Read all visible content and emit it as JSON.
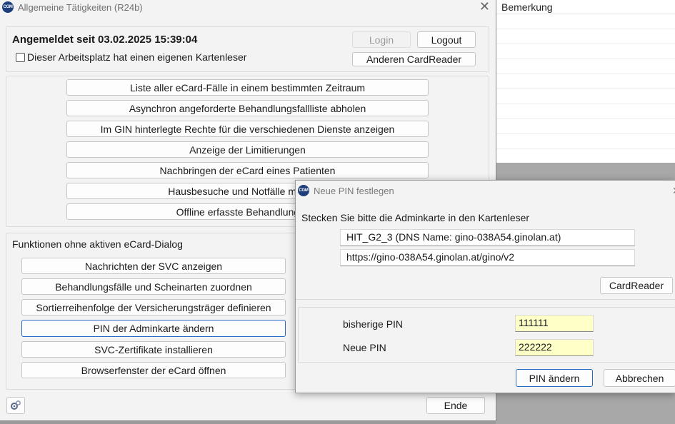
{
  "background_list": {
    "header": "Bemerkung"
  },
  "main_window": {
    "title": "Allgemeine Tätigkeiten (R24b)",
    "app_icon_text": "CGM",
    "close_glyph": "✕",
    "session": {
      "logged_in_label": "Angemeldet seit 03.02.2025 15:39:04",
      "own_reader_checkbox_label": "Dieser Arbeitsplatz hat einen eigenen Kartenleser",
      "login_button": "Login",
      "logout_button": "Logout",
      "other_reader_button": "Anderen CardReader"
    },
    "ecard_functions": [
      "Liste aller eCard-Fälle in einem bestimmten Zeitraum",
      "Asynchron angeforderte Behandlungsfallliste abholen",
      "Im GIN hinterlegte Rechte für die verschiedenen Dienste anzeigen",
      "Anzeige der Limitierungen",
      "Nachbringen der eCard eines Patienten",
      "Hausbesuche und Notfälle mit der o",
      "Offline erfasste Behandlungen ü"
    ],
    "offline_group_title": "Funktionen ohne aktiven eCard-Dialog",
    "offline_functions": [
      "Nachrichten der SVC anzeigen",
      "Behandlungsfälle und Scheinarten zuordnen",
      "Sortierreihenfolge der Versicherungsträger definieren",
      "PIN der Adminkarte ändern",
      "SVC-Zertifikate installieren",
      "Browserfenster der eCard öffnen"
    ],
    "end_button": "Ende",
    "gear_icon": "gear-icon"
  },
  "dialog": {
    "title": "Neue PIN festlegen",
    "app_icon_text": "CGM",
    "instruction": "Stecken Sie bitte die Adminkarte in den Kartenleser",
    "card_reader_name": "HIT_G2_3 (DNS Name: gino-038A54.ginolan.at)",
    "url": "https://gino-038A54.ginolan.at/gino/v2",
    "card_reader_button": "CardReader",
    "old_pin_label": "bisherige PIN",
    "old_pin_value": "111111",
    "new_pin_label": "Neue PIN",
    "new_pin_value": "222222",
    "change_pin_button": "PIN ändern",
    "cancel_button": "Abbrechen",
    "close_glyph": "✕"
  },
  "colors": {
    "accent_border": "#2a68c8",
    "pin_field_bg": "#ffffc8"
  }
}
